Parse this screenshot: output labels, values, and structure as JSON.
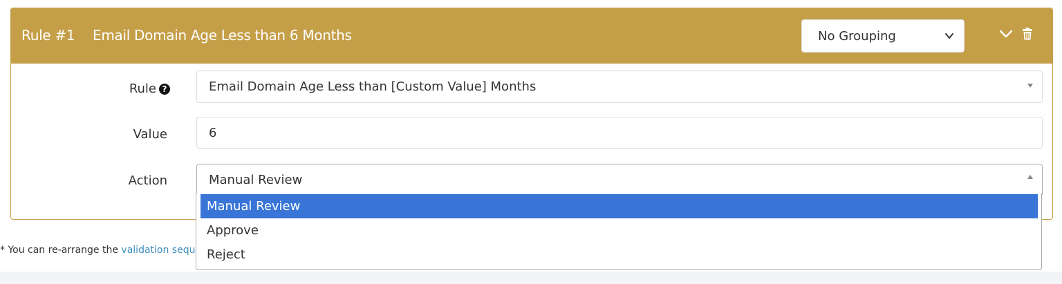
{
  "rule_header": {
    "number": "Rule #1",
    "title": "Email Domain Age Less than 6 Months",
    "grouping_value": "No Grouping",
    "collapse_icon": "chevron-down-icon",
    "delete_icon": "trash-icon"
  },
  "form": {
    "rule": {
      "label": "Rule",
      "help_icon_glyph": "?",
      "value": "Email Domain Age Less than [Custom Value] Months"
    },
    "value": {
      "label": "Value",
      "value": "6"
    },
    "action": {
      "label": "Action",
      "value": "Manual Review",
      "dropdown_open": true,
      "options": [
        "Manual Review",
        "Approve",
        "Reject"
      ],
      "highlighted_option": "Manual Review"
    }
  },
  "note": {
    "prefix": "* You can re-arrange the ",
    "link_text": "validation sequ"
  },
  "colors": {
    "header_gold": "#c59e48",
    "option_highlight": "#3875d7",
    "link_blue": "#3c8dbc"
  }
}
